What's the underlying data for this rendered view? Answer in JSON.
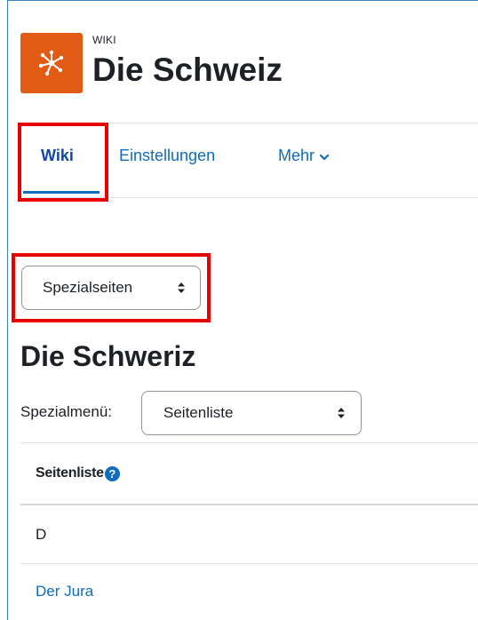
{
  "module": {
    "icon": "wiki-module-icon",
    "icon_color": "#e25b14",
    "label": "WIKI",
    "title": "Die Schweiz"
  },
  "nav": {
    "tabs": [
      {
        "label": "Wiki",
        "active": true
      },
      {
        "label": "Einstellungen",
        "active": false
      },
      {
        "label": "Mehr",
        "active": false
      }
    ],
    "more_icon": "chevron-down-icon"
  },
  "page_select": {
    "value": "Spezialseiten"
  },
  "content": {
    "heading": "Die Schweriz",
    "special_menu_label": "Spezialmenü:",
    "special_menu_value": "Seitenliste"
  },
  "table": {
    "header": "Seitenliste",
    "help_icon": "question-circle-icon",
    "rows": [
      {
        "text": "D",
        "type": "letter"
      },
      {
        "text": "Der Jura",
        "type": "link"
      }
    ]
  },
  "colors": {
    "accent": "#0f6cbf",
    "highlight": "#e60000"
  }
}
